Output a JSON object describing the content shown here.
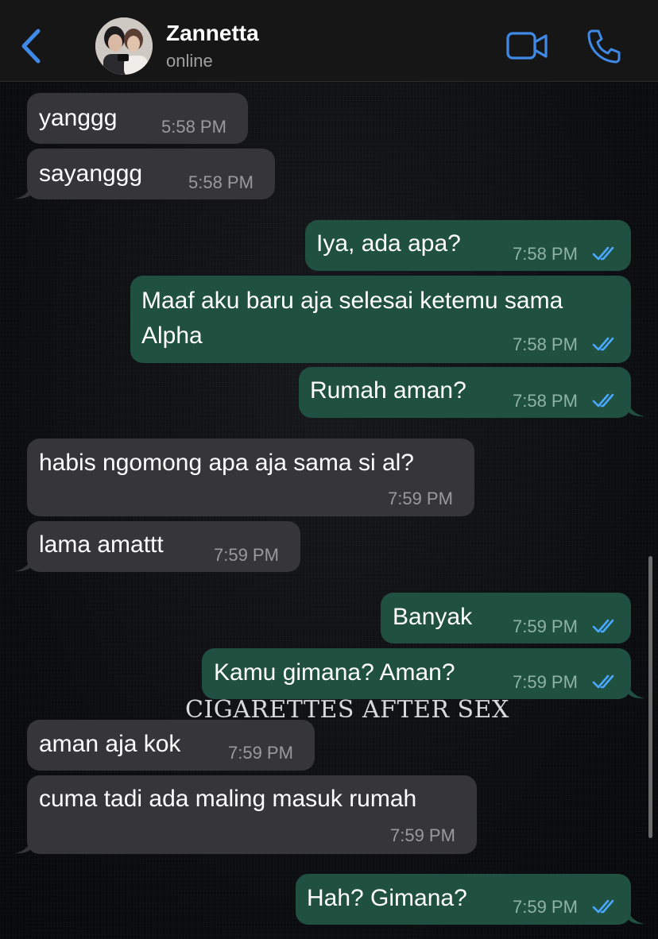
{
  "header": {
    "contact_name": "Zannetta",
    "status": "online",
    "accent_color": "#3e8ae6"
  },
  "messages": [
    {
      "dir": "in",
      "text": "yanggg",
      "time": "5:58 PM"
    },
    {
      "dir": "in",
      "text": "sayanggg",
      "time": "5:58 PM"
    },
    {
      "dir": "out",
      "text": "Iya, ada apa?",
      "time": "7:58 PM",
      "status": "read"
    },
    {
      "dir": "out",
      "text_line1": "Maaf aku baru aja selesai ketemu sama",
      "text_line2": "Alpha",
      "time": "7:58 PM",
      "status": "read"
    },
    {
      "dir": "out",
      "text": "Rumah aman?",
      "time": "7:58 PM",
      "status": "read"
    },
    {
      "dir": "in",
      "text": "habis ngomong apa aja sama si al?",
      "time": "7:59 PM"
    },
    {
      "dir": "in",
      "text": "lama amattt",
      "time": "7:59 PM"
    },
    {
      "dir": "out",
      "text": "Banyak",
      "time": "7:59 PM",
      "status": "read"
    },
    {
      "dir": "out",
      "text": "Kamu gimana? Aman?",
      "time": "7:59 PM",
      "status": "read"
    },
    {
      "dir": "in",
      "text": "aman aja kok",
      "time": "7:59 PM"
    },
    {
      "dir": "in",
      "text": "cuma tadi ada maling masuk rumah",
      "time": "7:59 PM"
    },
    {
      "dir": "out",
      "text": "Hah? Gimana?",
      "time": "7:59 PM",
      "status": "read"
    }
  ],
  "overlay": {
    "watermark": "CIGARETTES AFTER SEX"
  },
  "colors": {
    "incoming_bubble": "#363638",
    "outgoing_bubble": "#205040",
    "read_ticks": "#4aa8ff"
  },
  "icons": {
    "back": "chevron-left-icon",
    "video": "video-camera-icon",
    "call": "phone-icon",
    "read_receipt": "double-check-icon"
  }
}
